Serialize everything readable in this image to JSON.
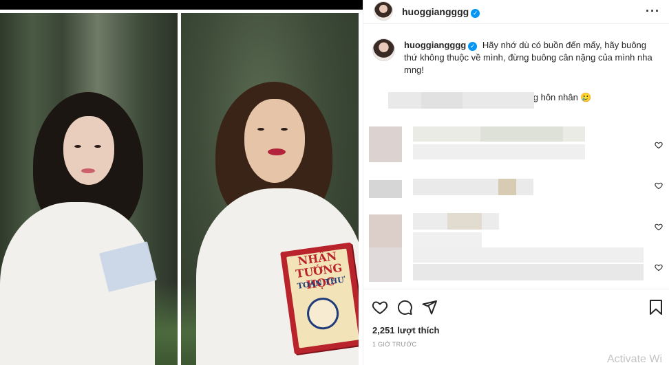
{
  "post": {
    "username": "huoggiangggg",
    "verified_mark": "✓",
    "more_icon": "more-horizontal-icon",
    "caption_line1": "Hãy nhớ dù có buồn đến mấy, hãy buông thứ không thuộc về mình, đừng buông cân nặng của mình nha mng!",
    "caption_line2": "Tôi trước và sau khi thất bại trong hôn nhân 🥲",
    "likes": "2,251 lượt thích",
    "time": "1 GIỜ TRƯỚC"
  },
  "photo": {
    "book_title_line1": "NHÂN TƯỚNG",
    "book_title_line2": "HỌC",
    "book_subtitle": "TOÀN THƯ"
  },
  "actions": {
    "like_icon": "heart-icon",
    "comment_icon": "comment-icon",
    "share_icon": "send-icon",
    "save_icon": "bookmark-icon"
  },
  "overlay": {
    "activate_text": "Activate Wi"
  },
  "colors": {
    "verified": "#0095f6",
    "text": "#262626",
    "muted": "#8e8e8e"
  }
}
